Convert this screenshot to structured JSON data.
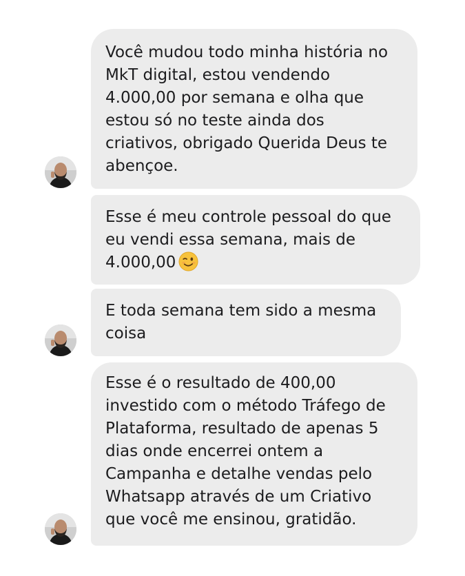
{
  "messages": [
    {
      "text": "Você mudou todo minha história no\nMkT digital, estou vendendo\n4.000,00 por semana e olha que\nestou só no teste ainda dos\ncriativos, obrigado Querida Deus te\nabençoe."
    },
    {
      "text": "Esse é meu controle pessoal do que\neu vendi essa semana, mais de\n4.000,00",
      "emoji": "winking-face"
    },
    {
      "text": "E toda semana tem sido a mesma\ncoisa"
    },
    {
      "text": "Esse é o resultado de 400,00\ninvestido com o método Tráfego de\nPlataforma, resultado de apenas 5\ndias onde encerrei ontem a\nCampanha e detalhe vendas pelo\nWhatsapp através de um Criativo\nque você me ensinou, gratidão."
    }
  ],
  "colors": {
    "bubble": "#ececec",
    "text": "#1c1c1e",
    "emoji": "#f7c23c"
  }
}
